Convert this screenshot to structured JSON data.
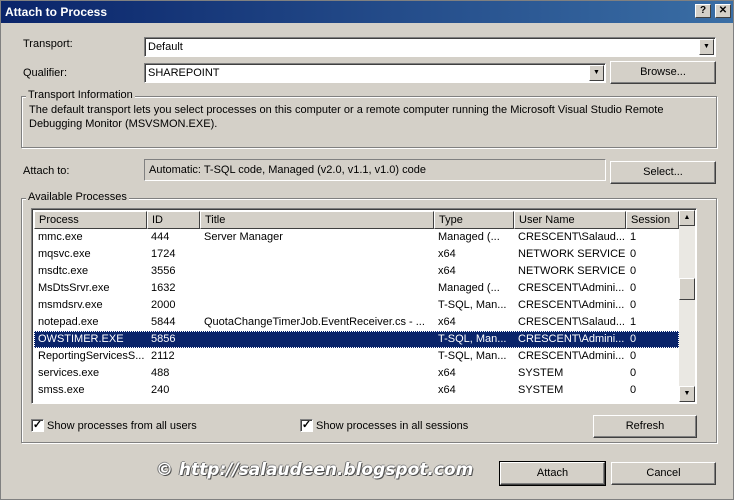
{
  "window": {
    "title": "Attach to Process",
    "help_label": "?",
    "close_label": "✕"
  },
  "transport": {
    "label": "Transport:",
    "value": "Default"
  },
  "qualifier": {
    "label": "Qualifier:",
    "value": "SHAREPOINT",
    "browse_label": "Browse..."
  },
  "transport_info": {
    "title": "Transport Information",
    "text": "The default transport lets you select processes on this computer or a remote computer running the Microsoft Visual Studio Remote Debugging Monitor (MSVSMON.EXE)."
  },
  "attach_to": {
    "label": "Attach to:",
    "value": "Automatic: T-SQL code, Managed (v2.0, v1.1, v1.0) code",
    "select_label": "Select..."
  },
  "available": {
    "title": "Available Processes",
    "columns": [
      "Process",
      "ID",
      "Title",
      "Type",
      "User Name",
      "Session"
    ],
    "rows": [
      {
        "process": "mmc.exe",
        "id": "444",
        "title": "Server Manager",
        "type": "Managed (...",
        "user": "CRESCENT\\Salaud...",
        "session": "1"
      },
      {
        "process": "mqsvc.exe",
        "id": "1724",
        "title": "",
        "type": "x64",
        "user": "NETWORK SERVICE",
        "session": "0"
      },
      {
        "process": "msdtc.exe",
        "id": "3556",
        "title": "",
        "type": "x64",
        "user": "NETWORK SERVICE",
        "session": "0"
      },
      {
        "process": "MsDtsSrvr.exe",
        "id": "1632",
        "title": "",
        "type": "Managed (...",
        "user": "CRESCENT\\Admini...",
        "session": "0"
      },
      {
        "process": "msmdsrv.exe",
        "id": "2000",
        "title": "",
        "type": "T-SQL, Man...",
        "user": "CRESCENT\\Admini...",
        "session": "0"
      },
      {
        "process": "notepad.exe",
        "id": "5844",
        "title": "QuotaChangeTimerJob.EventReceiver.cs - ...",
        "type": "x64",
        "user": "CRESCENT\\Salaud...",
        "session": "1"
      },
      {
        "process": "OWSTIMER.EXE",
        "id": "5856",
        "title": "",
        "type": "T-SQL, Man...",
        "user": "CRESCENT\\Admini...",
        "session": "0",
        "selected": true
      },
      {
        "process": "ReportingServicesS...",
        "id": "2112",
        "title": "",
        "type": "T-SQL, Man...",
        "user": "CRESCENT\\Admini...",
        "session": "0"
      },
      {
        "process": "services.exe",
        "id": "488",
        "title": "",
        "type": "x64",
        "user": "SYSTEM",
        "session": "0"
      },
      {
        "process": "smss.exe",
        "id": "240",
        "title": "",
        "type": "x64",
        "user": "SYSTEM",
        "session": "0"
      }
    ],
    "show_all_users": {
      "label": "Show processes from all users",
      "checked": true
    },
    "show_all_sessions": {
      "label": "Show processes in all sessions",
      "checked": true
    },
    "refresh_label": "Refresh"
  },
  "watermark": "© http://salaudeen.blogspot.com",
  "footer": {
    "attach_label": "Attach",
    "cancel_label": "Cancel"
  },
  "icons": {
    "dropdown": "chevron-down-icon",
    "scroll_up": "chevron-up-icon",
    "check": "checkmark-icon"
  }
}
